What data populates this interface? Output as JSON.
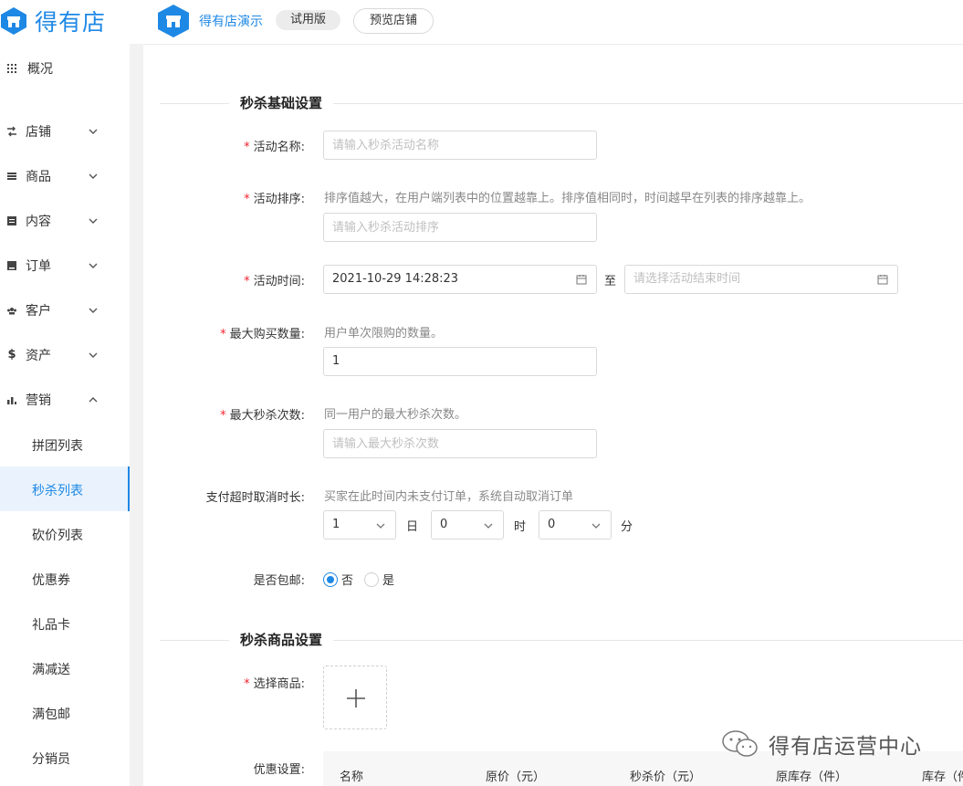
{
  "header": {
    "brand_name": "得有店",
    "shop_name": "得有店演示",
    "trial_badge": "试用版",
    "preview_button": "预览店铺"
  },
  "sidebar": {
    "items": [
      {
        "label": "概况",
        "icon": "grid-icon"
      },
      {
        "label": "店铺",
        "icon": "shop-icon"
      },
      {
        "label": "商品",
        "icon": "list-icon"
      },
      {
        "label": "内容",
        "icon": "document-icon"
      },
      {
        "label": "订单",
        "icon": "order-icon"
      },
      {
        "label": "客户",
        "icon": "users-icon"
      },
      {
        "label": "资产",
        "icon": "dollar-icon"
      },
      {
        "label": "营销",
        "icon": "bar-chart-icon"
      }
    ],
    "marketing_sub": [
      "拼团列表",
      "秒杀列表",
      "砍价列表",
      "优惠券",
      "礼品卡",
      "满减送",
      "满包邮",
      "分销员"
    ]
  },
  "form": {
    "basic_section_title": "秒杀基础设置",
    "name_label": "活动名称",
    "name_placeholder": "请输入秒杀活动名称",
    "sort_label": "活动排序",
    "sort_hint": "排序值越大，在用户端列表中的位置越靠上。排序值相同时，时间越早在列表的排序越靠上。",
    "sort_placeholder": "请输入秒杀活动排序",
    "time_label": "活动时间",
    "time_start": "2021-10-29 14:28:23",
    "time_to": "至",
    "time_end_placeholder": "请选择活动结束时间",
    "max_buy_label": "最大购买数量",
    "max_buy_hint": "用户单次限购的数量。",
    "max_buy_value": "1",
    "max_times_label": "最大秒杀次数",
    "max_times_hint": "同一用户的最大秒杀次数。",
    "max_times_placeholder": "请输入最大秒杀次数",
    "timeout_label": "支付超时取消时长",
    "timeout_hint": "买家在此时间内未支付订单，系统自动取消订单",
    "timeout_day": "1",
    "timeout_day_unit": "日",
    "timeout_hour": "0",
    "timeout_hour_unit": "时",
    "timeout_min": "0",
    "timeout_min_unit": "分",
    "shipping_label": "是否包邮",
    "shipping_no": "否",
    "shipping_yes": "是",
    "goods_section_title": "秒杀商品设置",
    "select_goods_label": "选择商品",
    "discount_label": "优惠设置",
    "table_headers": [
      "名称",
      "原价（元）",
      "秒杀价（元）",
      "原库存（件）",
      "库存（件）"
    ]
  },
  "watermark": "得有店运营中心",
  "colors": {
    "accent": "#1e88e5",
    "required": "#f5222d"
  }
}
